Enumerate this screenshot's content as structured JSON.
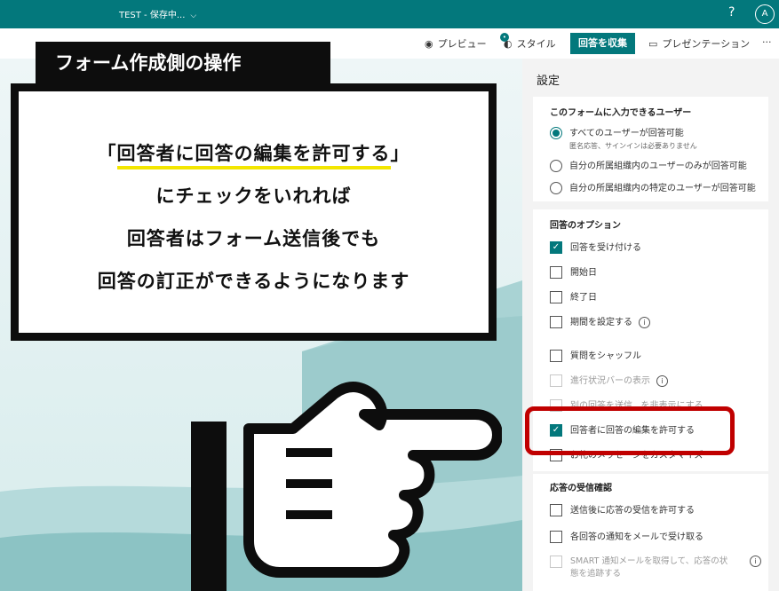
{
  "topbar": {
    "title": "TEST - 保存中...",
    "help_icon": "?",
    "avatar_label": "A"
  },
  "toolbar": {
    "preview_label": "プレビュー",
    "style_label": "スタイル",
    "collect_label": "回答を収集",
    "presentation_label": "プレゼンテーション",
    "more_label": "···",
    "accent": "#03787c"
  },
  "annotation": {
    "label": "フォーム作成側の操作",
    "lines": [
      "「",
      "回答者に回答の編集を許可する",
      "」",
      "にチェックをいれれば",
      "回答者はフォーム送信後でも",
      "回答の訂正ができるようになります"
    ],
    "highlight_color": "#f3e600"
  },
  "settings": {
    "heading": "設定",
    "who_can_fill": {
      "title": "このフォームに入力できるユーザー",
      "options": [
        {
          "label": "すべてのユーザーが回答可能",
          "sub": "匿名応答、サインインは必要ありません",
          "selected": true
        },
        {
          "label": "自分の所属組織内のユーザーのみが回答可能",
          "selected": false
        },
        {
          "label": "自分の所属組織内の特定のユーザーが回答可能",
          "selected": false
        }
      ]
    },
    "response_options": {
      "title": "回答のオプション",
      "items": [
        {
          "label": "回答を受け付ける",
          "checked": true
        },
        {
          "label": "開始日",
          "checked": false
        },
        {
          "label": "終了日",
          "checked": false
        },
        {
          "label": "期間を設定する",
          "checked": false
        },
        {
          "label": "質問をシャッフル",
          "checked": false
        },
        {
          "label": "進行状況バーの表示",
          "checked": false
        },
        {
          "label": "別の回答を送信...を非表示にする",
          "checked": false
        },
        {
          "label": "回答者に回答の編集を許可する",
          "checked": true
        },
        {
          "label": "お礼のメッセージをカスタマイズ",
          "checked": false
        }
      ]
    },
    "receipt": {
      "title": "応答の受信確認",
      "items": [
        {
          "label": "送信後に応答の受信を許可する",
          "checked": false
        },
        {
          "label": "各回答の通知をメールで受け取る",
          "checked": false
        },
        {
          "label": "SMART 通知メールを取得して、応答の状態を追跡する",
          "checked": false
        }
      ]
    }
  }
}
